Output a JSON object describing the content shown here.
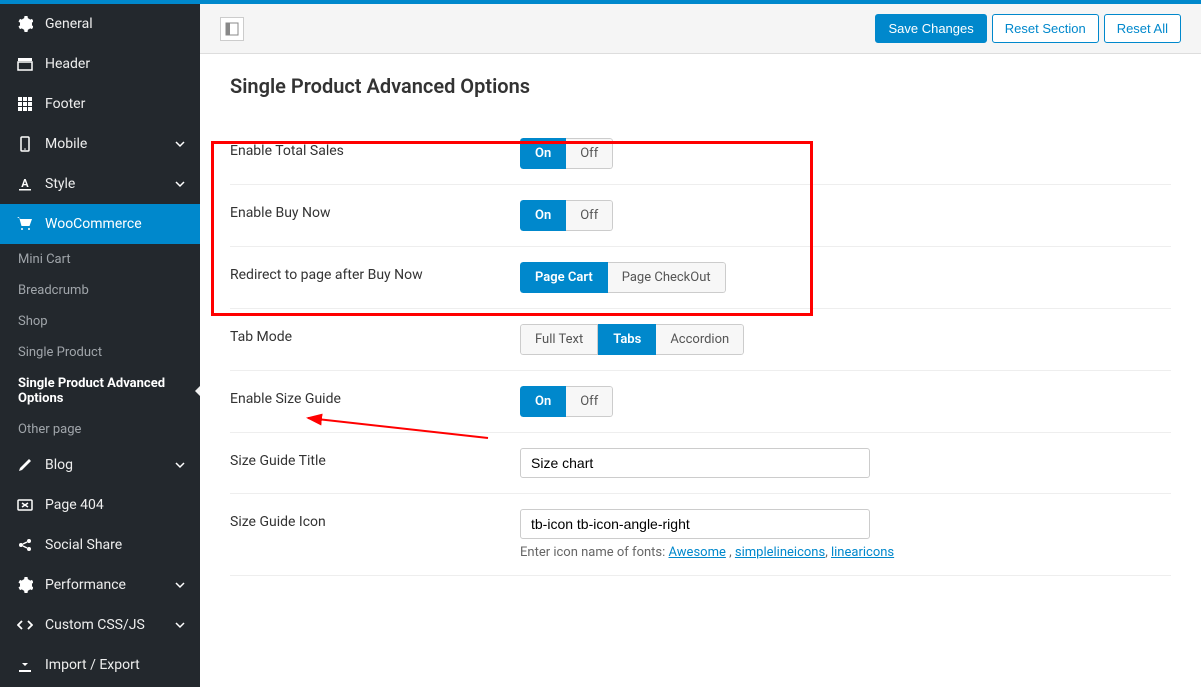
{
  "sidebar": {
    "items": [
      {
        "label": "General",
        "icon": "gear"
      },
      {
        "label": "Header",
        "icon": "layout-top"
      },
      {
        "label": "Footer",
        "icon": "grid"
      },
      {
        "label": "Mobile",
        "icon": "mobile",
        "chevron": true
      },
      {
        "label": "Style",
        "icon": "underline-a",
        "chevron": true
      },
      {
        "label": "WooCommerce",
        "icon": "cart",
        "active": true
      },
      {
        "label": "Blog",
        "icon": "pencil",
        "chevron": true
      },
      {
        "label": "Page 404",
        "icon": "error"
      },
      {
        "label": "Social Share",
        "icon": "share"
      },
      {
        "label": "Performance",
        "icon": "gear-bold",
        "chevron": true
      },
      {
        "label": "Custom CSS/JS",
        "icon": "code",
        "chevron": true
      },
      {
        "label": "Import / Export",
        "icon": "download"
      }
    ],
    "subitems": [
      {
        "label": "Mini Cart"
      },
      {
        "label": "Breadcrumb"
      },
      {
        "label": "Shop"
      },
      {
        "label": "Single Product"
      },
      {
        "label": "Single Product Advanced Options",
        "active": true
      },
      {
        "label": "Other page"
      }
    ]
  },
  "toolbar": {
    "save_label": "Save Changes",
    "reset_section_label": "Reset Section",
    "reset_all_label": "Reset All"
  },
  "page": {
    "title": "Single Product Advanced Options"
  },
  "fields": {
    "enable_total_sales": {
      "label": "Enable Total Sales",
      "on": "On",
      "off": "Off",
      "value": "On"
    },
    "enable_buy_now": {
      "label": "Enable Buy Now",
      "on": "On",
      "off": "Off",
      "value": "On"
    },
    "redirect_after_buy_now": {
      "label": "Redirect to page after Buy Now",
      "opt1": "Page Cart",
      "opt2": "Page CheckOut",
      "value": "Page Cart"
    },
    "tab_mode": {
      "label": "Tab Mode",
      "opt1": "Full Text",
      "opt2": "Tabs",
      "opt3": "Accordion",
      "value": "Tabs"
    },
    "enable_size_guide": {
      "label": "Enable Size Guide",
      "on": "On",
      "off": "Off",
      "value": "On"
    },
    "size_guide_title": {
      "label": "Size Guide Title",
      "value": "Size chart"
    },
    "size_guide_icon": {
      "label": "Size Guide Icon",
      "value": "tb-icon tb-icon-angle-right",
      "helper_prefix": "Enter icon name of fonts: ",
      "link1": "Awesome",
      "link2": "simplelineicons",
      "link3": "linearicons"
    }
  }
}
